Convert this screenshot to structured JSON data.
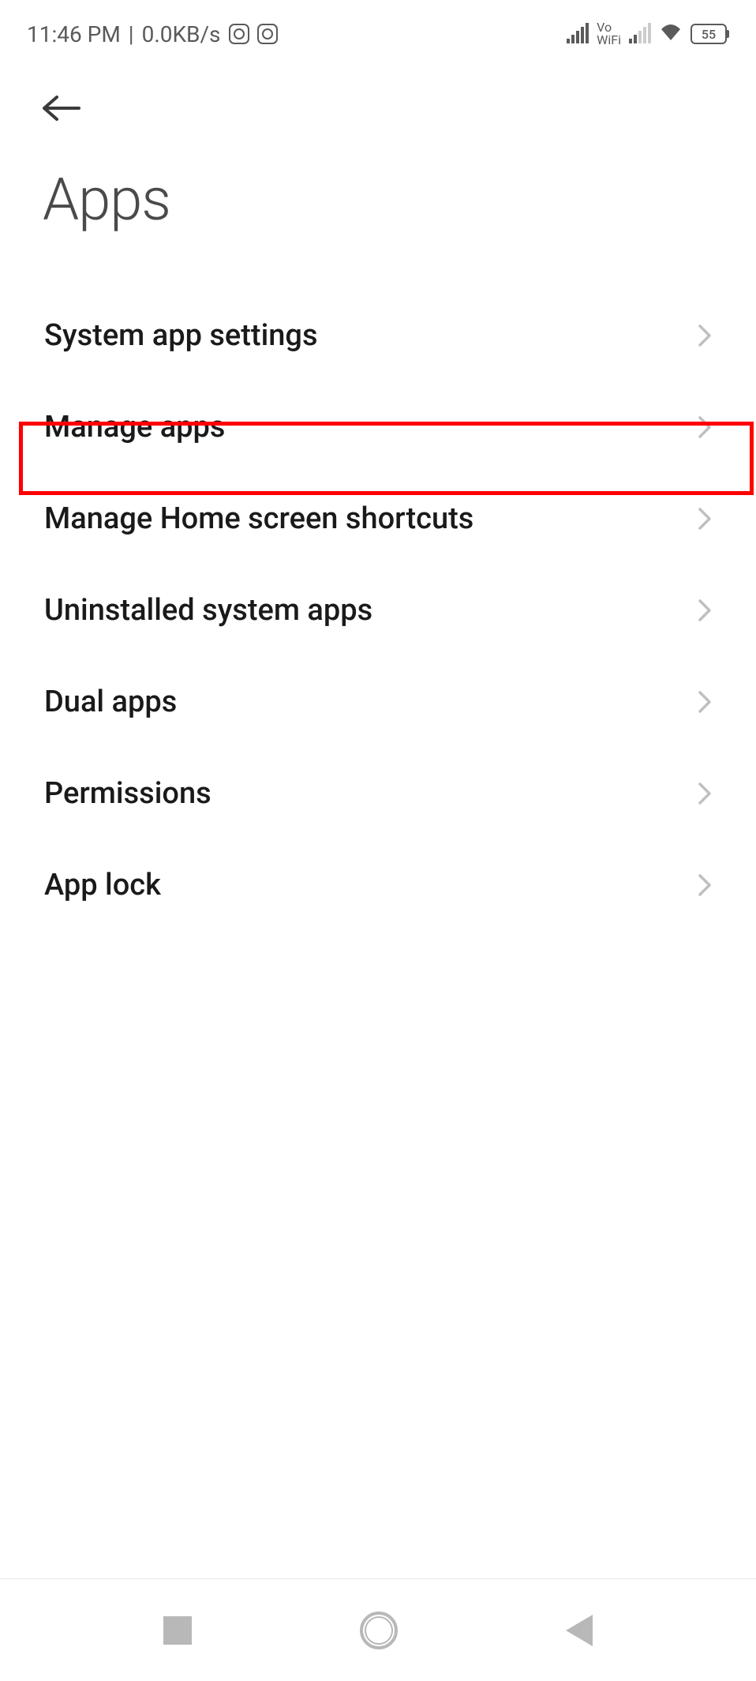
{
  "status_bar": {
    "time": "11:46 PM",
    "separator": "|",
    "data_speed": "0.0KB/s",
    "vowifi_top": "Vo",
    "vowifi_bottom": "WiFi",
    "battery_level": "55"
  },
  "header": {
    "title": "Apps"
  },
  "list": {
    "items": [
      {
        "label": "System app settings"
      },
      {
        "label": "Manage apps"
      },
      {
        "label": "Manage Home screen shortcuts"
      },
      {
        "label": "Uninstalled system apps"
      },
      {
        "label": "Dual apps"
      },
      {
        "label": "Permissions"
      },
      {
        "label": "App lock"
      }
    ]
  },
  "highlight": {
    "index": 1
  }
}
